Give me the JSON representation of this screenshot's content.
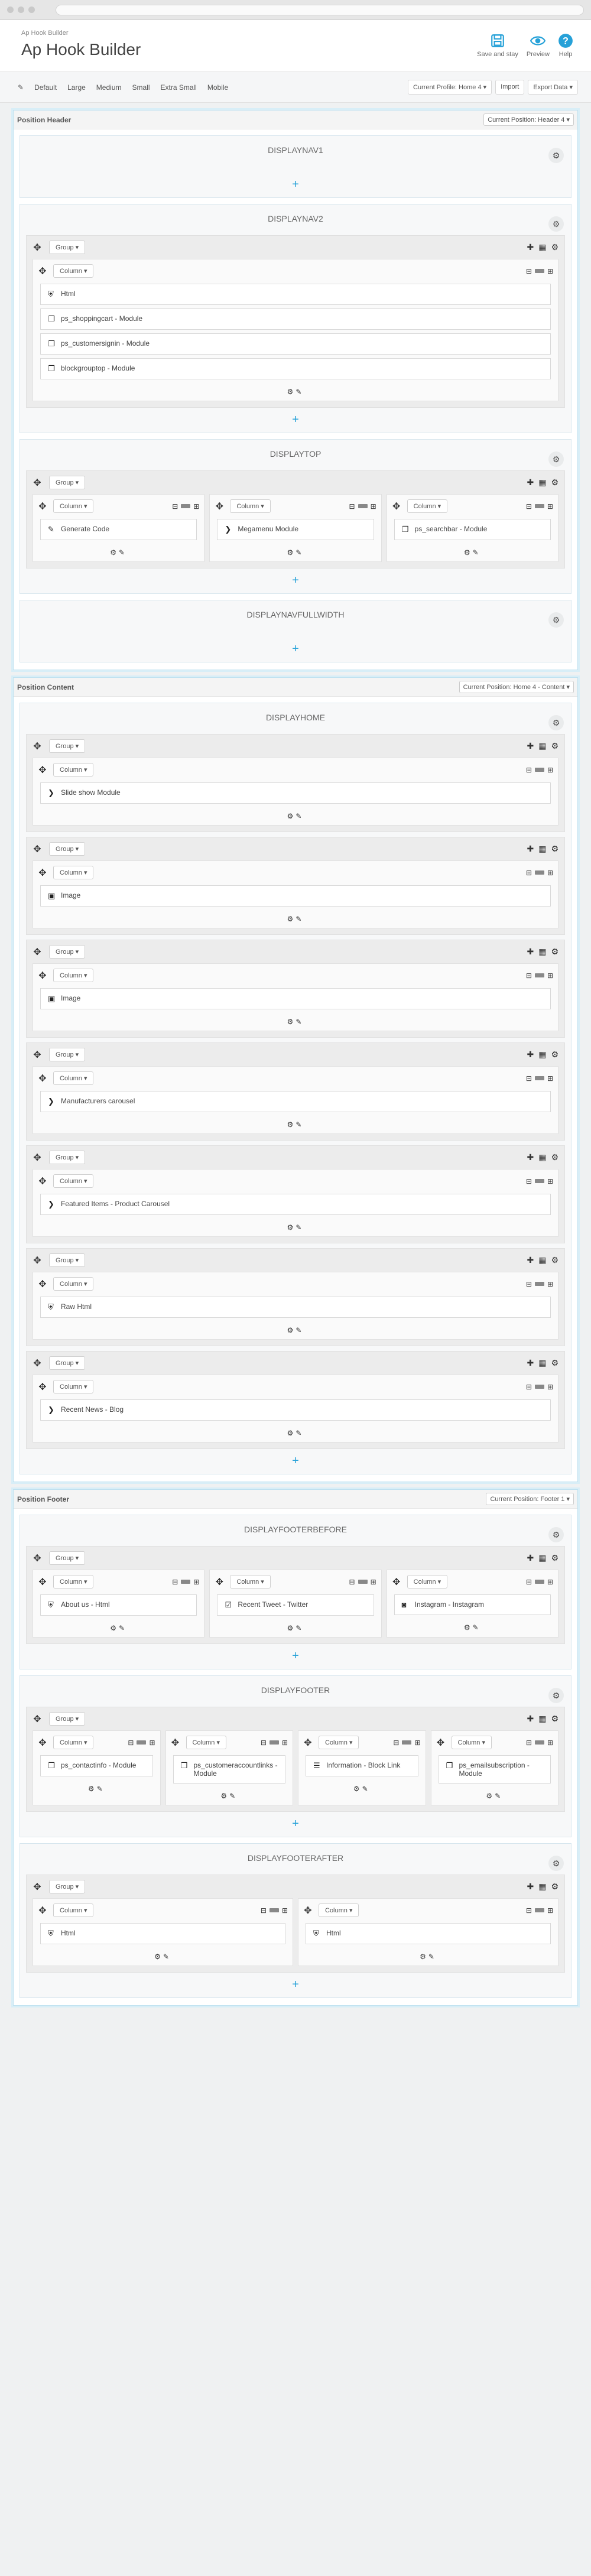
{
  "topbar": {
    "breadcrumb": "Ap Hook Builder",
    "title": "Ap Hook Builder",
    "buttons": {
      "save": "Save and stay",
      "preview": "Preview",
      "help": "Help"
    }
  },
  "profilebar": {
    "items": [
      "Default",
      "Large",
      "Medium",
      "Small",
      "Extra Small",
      "Mobile"
    ],
    "profile": "Current Profile: Home 4 ▾",
    "import": "Import",
    "export": "Export Data ▾"
  },
  "labels": {
    "group": "Group ▾",
    "column": "Column ▾"
  },
  "positions": [
    {
      "title": "Position Header",
      "select": "Current Position: Header 4 ▾",
      "hooks": [
        {
          "name": "DISPLAYNAV1",
          "groups": []
        },
        {
          "name": "DISPLAYNAV2",
          "groups": [
            [
              [
                "Html|shield",
                "ps_shoppingcart - Module|copy",
                "ps_customersignin - Module|copy",
                "blockgrouptop - Module|copy"
              ]
            ]
          ]
        },
        {
          "name": "DISPLAYTOP",
          "groups": [
            [
              [
                "Generate Code|pencil"
              ],
              [
                "Megamenu Module|chev"
              ],
              [
                "ps_searchbar - Module|copy"
              ]
            ]
          ]
        },
        {
          "name": "DISPLAYNAVFULLWIDTH",
          "groups": []
        }
      ]
    },
    {
      "title": "Position Content",
      "select": "Current Position: Home 4 - Content ▾",
      "hooks": [
        {
          "name": "DISPLAYHOME",
          "groups": [
            [
              [
                "Slide show Module|chev"
              ]
            ],
            [
              [
                "Image|image"
              ]
            ],
            [
              [
                "Image|image"
              ]
            ],
            [
              [
                "Manufacturers carousel|chev"
              ]
            ],
            [
              [
                "Featured Items - Product Carousel|chev"
              ]
            ],
            [
              [
                "Raw Html|shield"
              ]
            ],
            [
              [
                "Recent News - Blog|chev"
              ]
            ]
          ]
        }
      ]
    },
    {
      "title": "Position Footer",
      "select": "Current Position: Footer 1 ▾",
      "hooks": [
        {
          "name": "DISPLAYFOOTERBEFORE",
          "groups": [
            [
              [
                "About us - Html|shield"
              ],
              [
                "Recent Tweet - Twitter|check"
              ],
              [
                "Instagram - Instagram|insta"
              ]
            ]
          ]
        },
        {
          "name": "DISPLAYFOOTER",
          "groups": [
            [
              [
                "ps_contactinfo - Module|copy"
              ],
              [
                "ps_customeraccountlinks - Module|copy"
              ],
              [
                "Information - Block Link|list"
              ],
              [
                "ps_emailsubscription - Module|copy"
              ]
            ]
          ]
        },
        {
          "name": "DISPLAYFOOTERAFTER",
          "groups": [
            [
              [
                "Html|shield"
              ],
              [
                "Html|shield"
              ]
            ]
          ]
        }
      ]
    }
  ],
  "icons": {
    "shield": "shield-icon",
    "copy": "copy-icon",
    "pencil": "pencil-icon",
    "chev": "chevron-right-icon",
    "image": "image-icon",
    "check": "check-square-icon",
    "insta": "instagram-icon",
    "list": "list-icon"
  }
}
